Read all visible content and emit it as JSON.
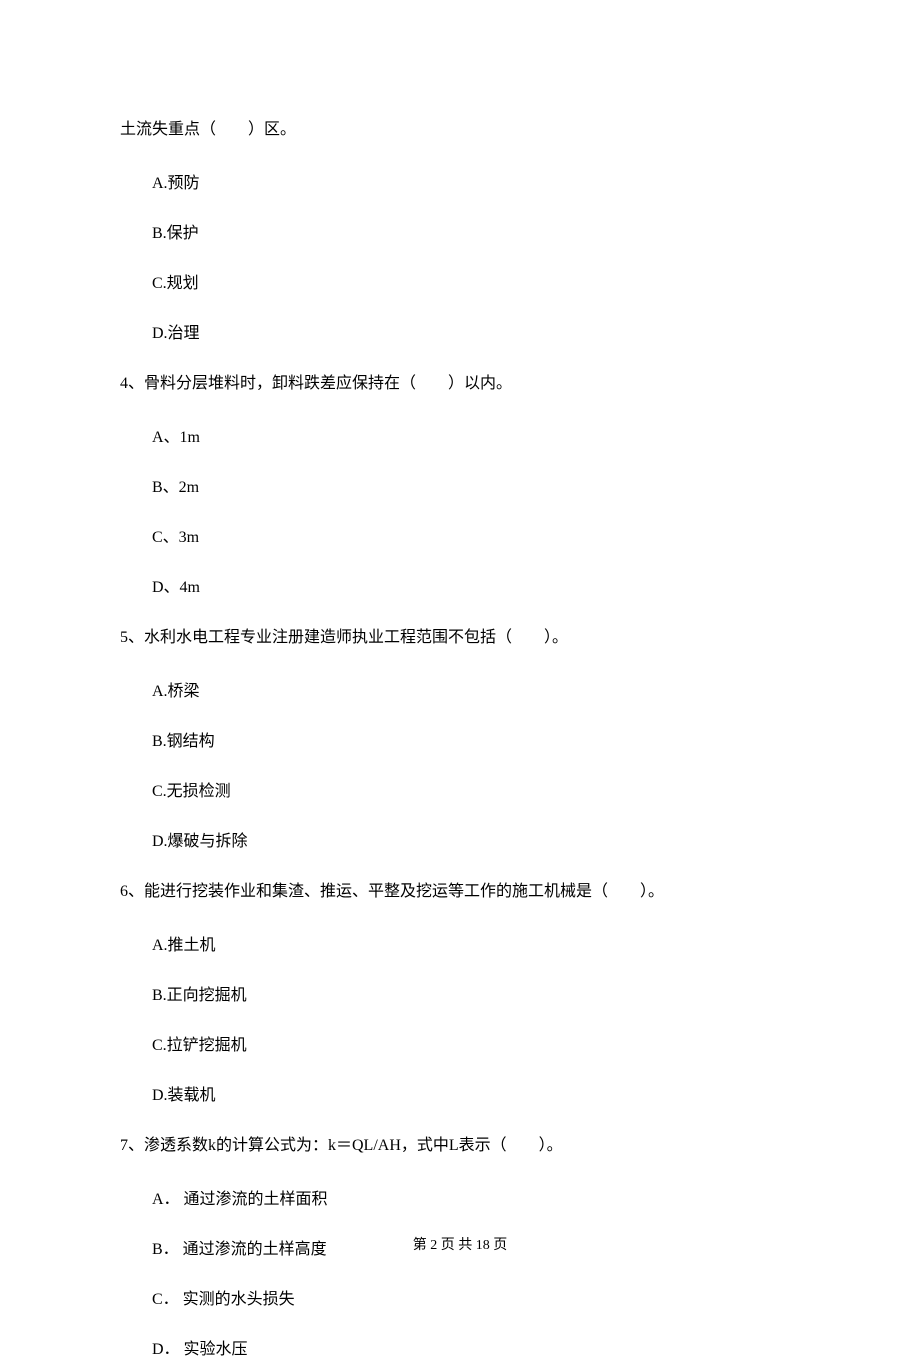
{
  "continuation": "土流失重点（　　）区。",
  "q3_options": {
    "a": "A.预防",
    "b": "B.保护",
    "c": "C.规划",
    "d": "D.治理"
  },
  "q4": {
    "text": "4、骨料分层堆料时，卸料跌差应保持在（　　）以内。",
    "a": "A、1m",
    "b": "B、2m",
    "c": "C、3m",
    "d": "D、4m"
  },
  "q5": {
    "text": "5、水利水电工程专业注册建造师执业工程范围不包括（　　）。",
    "a": "A.桥梁",
    "b": "B.钢结构",
    "c": "C.无损检测",
    "d": "D.爆破与拆除"
  },
  "q6": {
    "text": "6、能进行挖装作业和集渣、推运、平整及挖运等工作的施工机械是（　　）。",
    "a": "A.推土机",
    "b": "B.正向挖掘机",
    "c": "C.拉铲挖掘机",
    "d": "D.装载机"
  },
  "q7": {
    "text": "7、渗透系数k的计算公式为：k＝QL/AH，式中L表示（　　）。",
    "a": "A． 通过渗流的土样面积",
    "b": "B． 通过渗流的土样高度",
    "c": "C． 实测的水头损失",
    "d": "D． 实验水压"
  },
  "footer": "第 2 页 共 18 页"
}
